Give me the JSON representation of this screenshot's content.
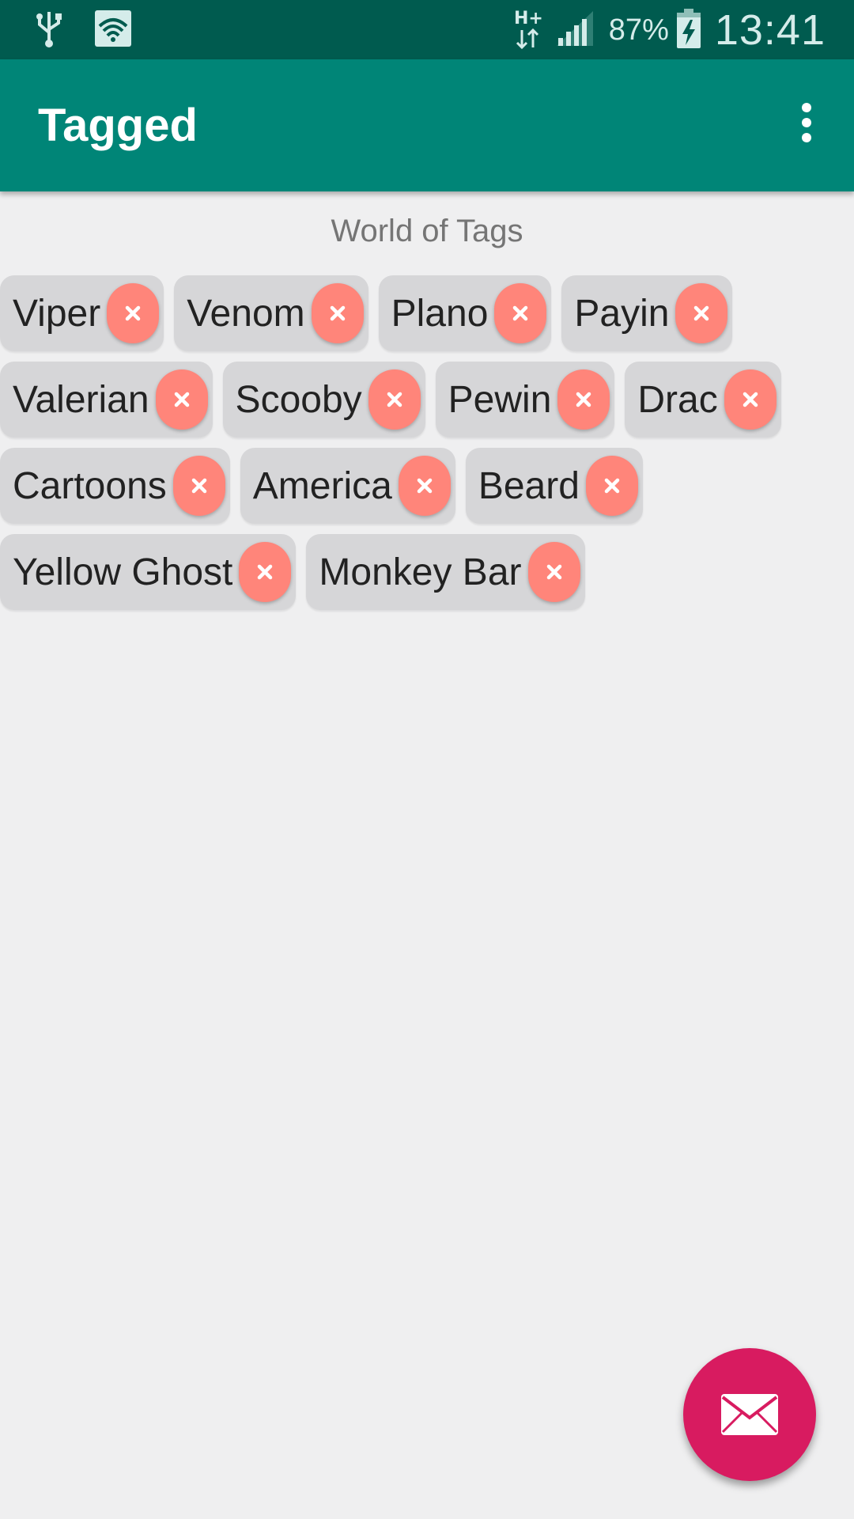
{
  "status_bar": {
    "battery_percent": "87%",
    "time": "13:41",
    "icons": [
      "usb-icon",
      "wifi-icon",
      "hplus-data-icon",
      "signal-icon",
      "battery-charging-icon"
    ]
  },
  "app_bar": {
    "title": "Tagged",
    "menu_icon": "overflow-menu-icon"
  },
  "content": {
    "subtitle": "World of Tags",
    "tag_rows": [
      [
        "Viper",
        "Venom",
        "Plano",
        "Payin"
      ],
      [
        "Valerian",
        "Scooby",
        "Pewin",
        "Drac"
      ],
      [
        "Cartoons",
        "America",
        "Beard"
      ],
      [
        "Yellow Ghost",
        "Monkey Bar"
      ]
    ],
    "remove_icon": "close-icon"
  },
  "fab": {
    "icon": "mail-icon"
  },
  "colors": {
    "status_bar": "#005b4f",
    "app_bar": "#008577",
    "background": "#efeff0",
    "chip": "#d6d6d8",
    "chip_remove": "#ff857a",
    "fab": "#d81b60"
  }
}
